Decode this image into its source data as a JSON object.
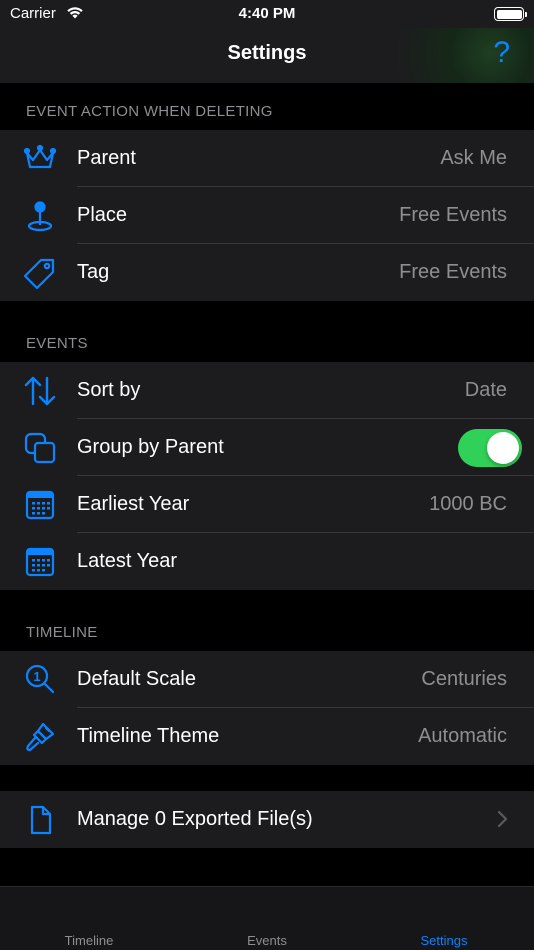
{
  "status_bar": {
    "carrier": "Carrier",
    "time": "4:40 PM"
  },
  "nav": {
    "title": "Settings",
    "help_label": "?"
  },
  "sections": {
    "deleting": {
      "header": "EVENT ACTION WHEN DELETING",
      "rows": [
        {
          "label": "Parent",
          "value": "Ask Me",
          "icon": "crown-icon"
        },
        {
          "label": "Place",
          "value": "Free Events",
          "icon": "map-pin-icon"
        },
        {
          "label": "Tag",
          "value": "Free Events",
          "icon": "tag-icon"
        }
      ]
    },
    "events": {
      "header": "EVENTS",
      "rows": [
        {
          "label": "Sort by",
          "value": "Date",
          "icon": "sort-arrows-icon"
        },
        {
          "label": "Group by Parent",
          "toggle_on": true,
          "icon": "group-squares-icon"
        },
        {
          "label": "Earliest Year",
          "value": "1000 BC",
          "icon": "calendar-icon"
        },
        {
          "label": "Latest Year",
          "value": "",
          "icon": "calendar-icon"
        }
      ]
    },
    "timeline": {
      "header": "TIMELINE",
      "rows": [
        {
          "label": "Default Scale",
          "value": "Centuries",
          "icon": "magnifier-icon"
        },
        {
          "label": "Timeline Theme",
          "value": "Automatic",
          "icon": "paintbrush-icon"
        }
      ]
    },
    "files": {
      "rows": [
        {
          "label": "Manage 0 Exported File(s)",
          "icon": "document-icon"
        }
      ]
    }
  },
  "tabs": [
    {
      "label": "Timeline",
      "active": false
    },
    {
      "label": "Events",
      "active": false
    },
    {
      "label": "Settings",
      "active": true
    }
  ],
  "colors": {
    "accent": "#0a84ff",
    "toggle_on": "#30d158",
    "secondary_text": "#8e8e93"
  }
}
